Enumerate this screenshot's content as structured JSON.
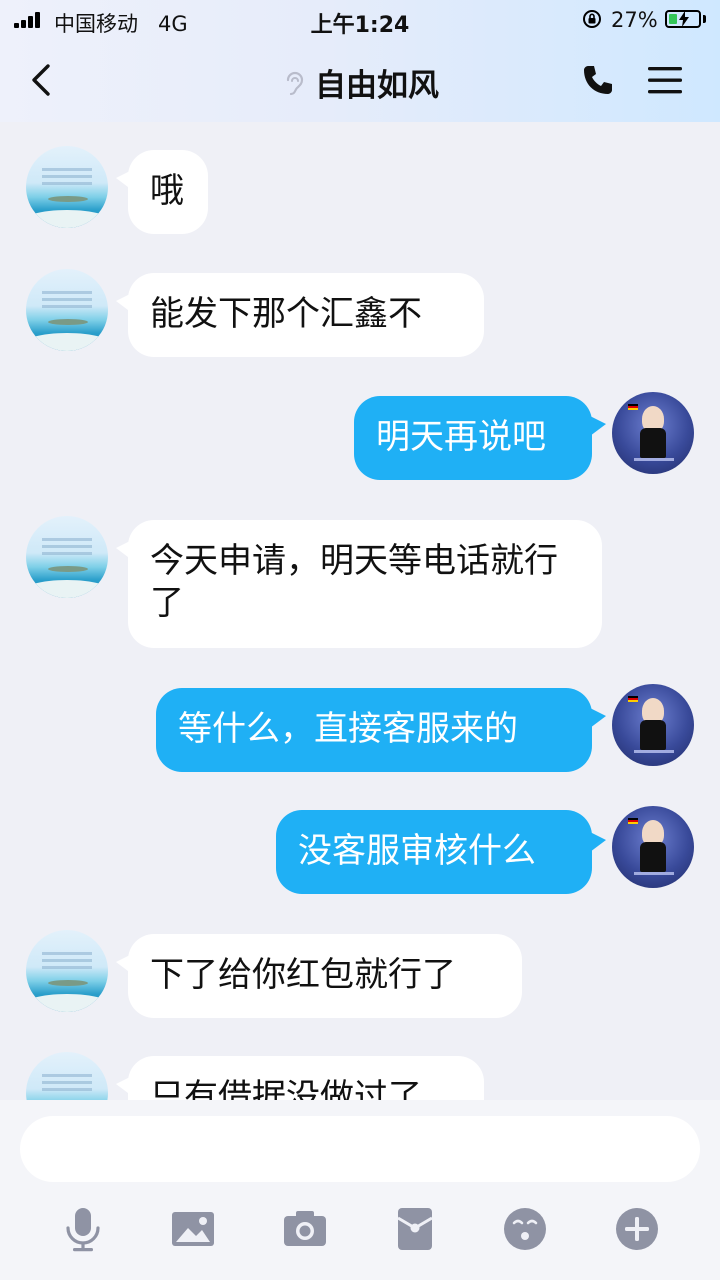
{
  "status_bar": {
    "carrier": "中国移动   4G",
    "time": "上午1:24",
    "battery_percent": "27%",
    "battery_level": 0.27
  },
  "header": {
    "title": "自由如风"
  },
  "messages": [
    {
      "side": "left",
      "text": "哦"
    },
    {
      "side": "left",
      "text": "能发下那个汇鑫不"
    },
    {
      "side": "right",
      "text": "明天再说吧"
    },
    {
      "side": "left",
      "text": "今天申请，明天等电话就行了"
    },
    {
      "side": "right",
      "text": "等什么，直接客服来的"
    },
    {
      "side": "right",
      "text": "没客服审核什么"
    },
    {
      "side": "left",
      "text": "下了给你红包就行了"
    },
    {
      "side": "left",
      "text": "只有借据没做过了"
    }
  ],
  "composer": {
    "placeholder": ""
  },
  "toolbar": [
    "mic-icon",
    "image-icon",
    "camera-icon",
    "red-packet-icon",
    "emoji-icon",
    "plus-icon"
  ],
  "colors": {
    "outgoing_bubble": "#1fb0f5",
    "incoming_bubble": "#ffffff",
    "background": "#eff0f6",
    "toolbar_icon": "#8f93a4"
  }
}
